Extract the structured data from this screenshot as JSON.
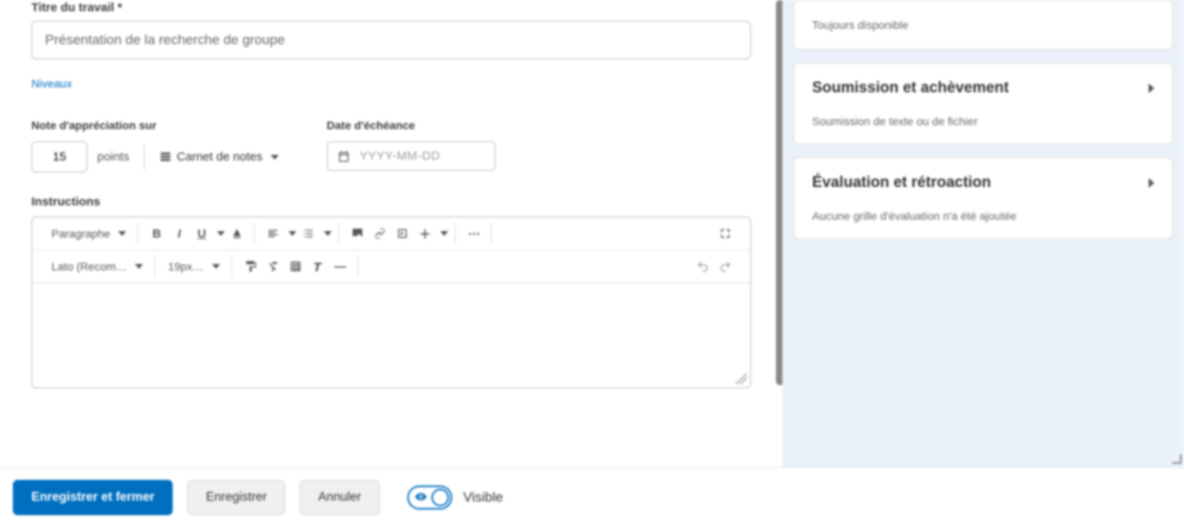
{
  "main": {
    "title_label": "Titre du travail *",
    "title_value": "Présentation de la recherche de groupe",
    "nominate_link": "Niveaux",
    "grade": {
      "label": "Note d'appréciation sur",
      "value": "15",
      "points_text": "points",
      "gradebook_link": "Carnet de notes"
    },
    "due": {
      "label": "Date d'échéance",
      "placeholder": "YYYY-MM-DD"
    },
    "instructions_label": "Instructions",
    "editor": {
      "paragraph": "Paragraphe",
      "font_family": "Lato (Recom…",
      "font_size": "19px…"
    }
  },
  "sidebar": {
    "availability_summary": "Toujours disponible",
    "submission": {
      "title": "Soumission et achèvement",
      "summary": "Soumission de texte ou de fichier"
    },
    "evaluation": {
      "title": "Évaluation et rétroaction",
      "summary": "Aucune grille d'évaluation n'a été ajoutée"
    }
  },
  "footer": {
    "save_close": "Enregistrer et fermer",
    "save": "Enregistrer",
    "cancel": "Annuler",
    "visibility_label": "Visible"
  }
}
